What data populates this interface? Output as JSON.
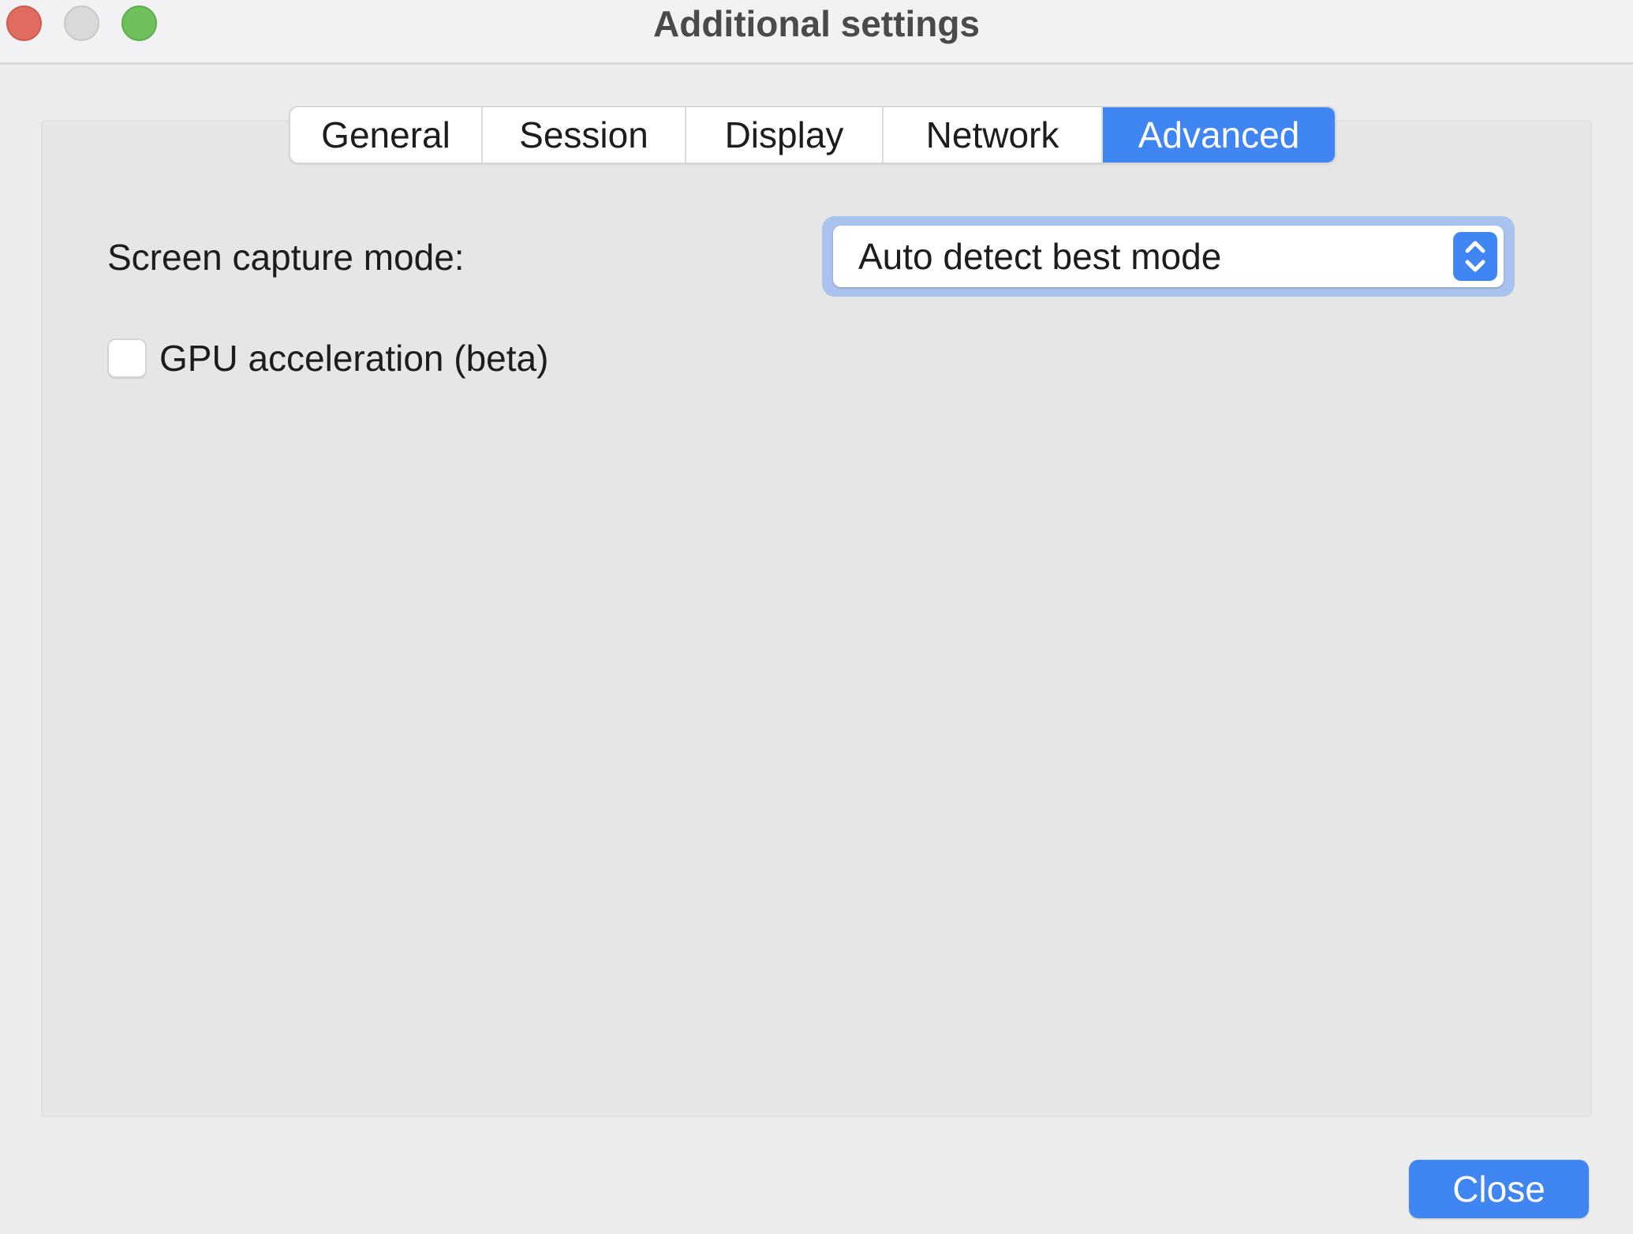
{
  "window": {
    "title": "Additional settings"
  },
  "tabs": [
    {
      "label": "General"
    },
    {
      "label": "Session"
    },
    {
      "label": "Display"
    },
    {
      "label": "Network"
    },
    {
      "label": "Advanced",
      "selected": true
    }
  ],
  "advanced": {
    "capture_mode_label": "Screen capture mode:",
    "capture_mode_value": "Auto detect best mode",
    "gpu_label": "GPU acceleration (beta)",
    "gpu_checked": false
  },
  "footer": {
    "close_label": "Close"
  },
  "colors": {
    "accent": "#3f86f3",
    "traffic_close": "#e06c60",
    "traffic_minimize": "#d9d9db",
    "traffic_zoom": "#6fc05b"
  },
  "icons": {
    "stepper": "chevron-up-down-icon"
  }
}
